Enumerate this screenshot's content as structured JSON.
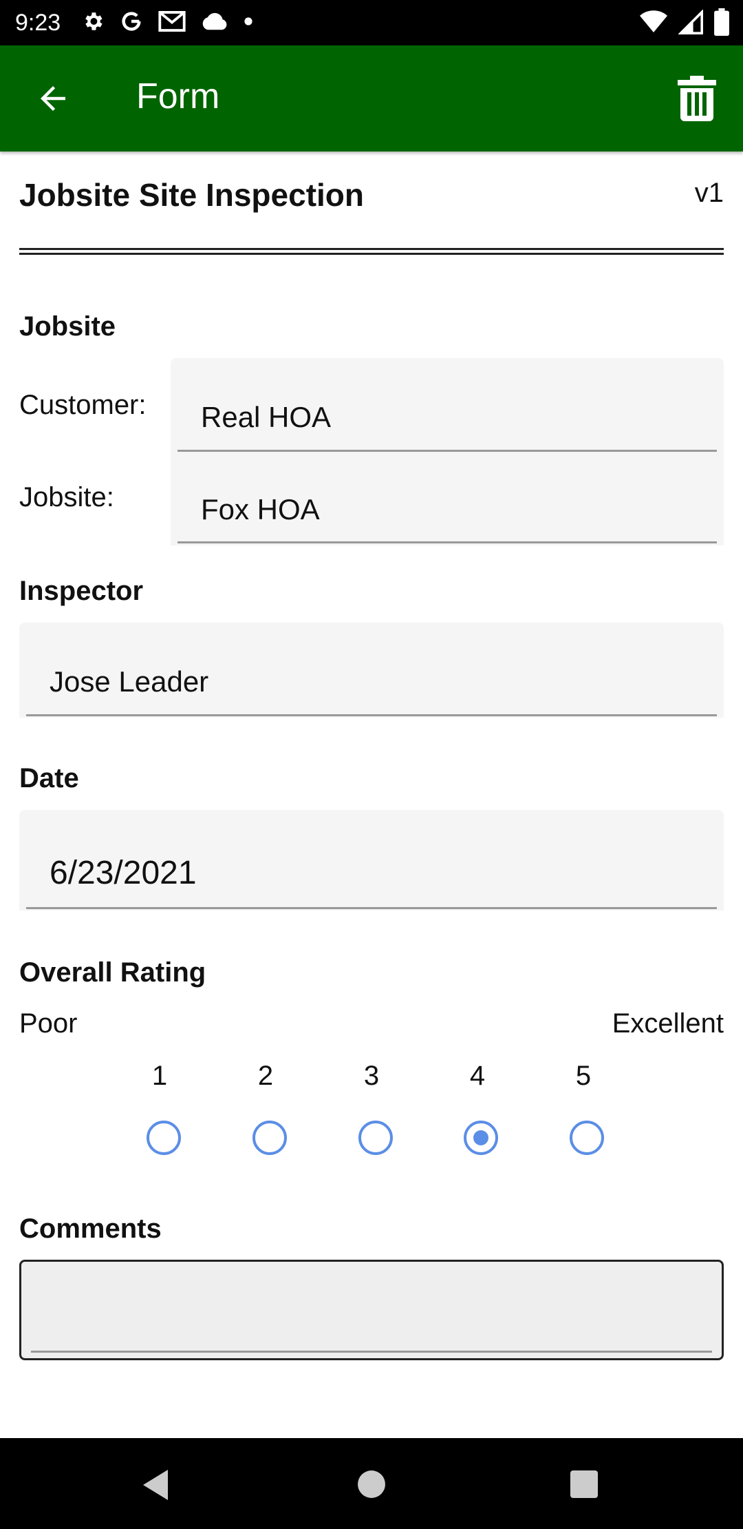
{
  "status_bar": {
    "time": "9:23",
    "left_icons": [
      "gear-icon",
      "google-icon",
      "gmail-icon",
      "cloud-icon",
      "dot-icon"
    ],
    "right_icons": [
      "wifi-icon",
      "signal-icon",
      "battery-icon"
    ]
  },
  "app_bar": {
    "title": "Form",
    "back_icon": "arrow-left-icon",
    "delete_icon": "trash-icon",
    "color": "#006400"
  },
  "form": {
    "title": "Jobsite Site Inspection",
    "version": "v1"
  },
  "jobsite": {
    "label": "Jobsite",
    "customer_label": "Customer:",
    "customer_value": "Real HOA",
    "jobsite_label": "Jobsite:",
    "jobsite_value": "Fox HOA"
  },
  "inspector": {
    "label": "Inspector",
    "value": "Jose Leader"
  },
  "date": {
    "label": "Date",
    "value": "6/23/2021"
  },
  "rating": {
    "label": "Overall Rating",
    "low_label": "Poor",
    "high_label": "Excellent",
    "options": [
      "1",
      "2",
      "3",
      "4",
      "5"
    ],
    "selected": "4",
    "accent": "#5b8ee6"
  },
  "comments": {
    "label": "Comments",
    "value": ""
  },
  "nav_bar": {
    "icons": [
      "back-triangle-icon",
      "home-circle-icon",
      "recents-square-icon"
    ]
  }
}
